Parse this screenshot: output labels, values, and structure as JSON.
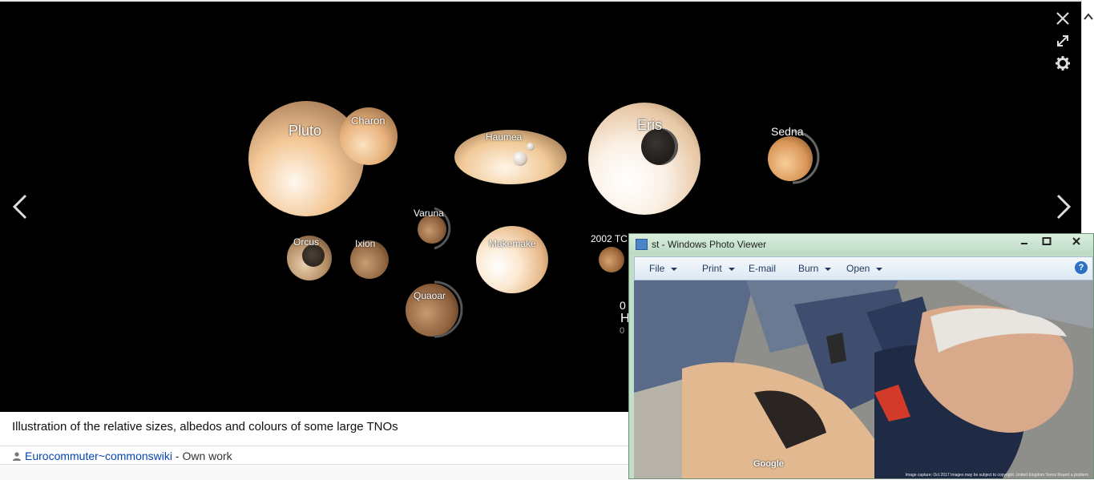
{
  "viewer": {
    "planets": [
      {
        "name": "Pluto"
      },
      {
        "name": "Charon"
      },
      {
        "name": "Haumea"
      },
      {
        "name": "Eris"
      },
      {
        "name": "Sedna"
      },
      {
        "name": "Varuna"
      },
      {
        "name": "Orcus"
      },
      {
        "name": "Ixion"
      },
      {
        "name": "Makemake"
      },
      {
        "name": "Quaoar"
      },
      {
        "name": "2002 TC"
      }
    ],
    "partial_text": [
      "0",
      "H",
      "0"
    ],
    "icons": {
      "close": "close-icon",
      "expand": "expand-icon",
      "settings": "gear-icon",
      "prev": "chevron-left-icon",
      "next": "chevron-right-icon"
    }
  },
  "caption": "Illustration of the relative sizes, albedos and colours of some large TNOs",
  "author": {
    "name": "Eurocommuter~commonswiki",
    "suffix": " - Own work"
  },
  "photo_viewer": {
    "title": "st - Windows Photo Viewer",
    "menu": [
      {
        "label": "File"
      },
      {
        "label": "Print"
      },
      {
        "label": "E-mail"
      },
      {
        "label": "Burn"
      },
      {
        "label": "Open"
      }
    ],
    "help": "?",
    "watermark": "Google",
    "fine_print": "Image capture: Oct 2017   Images may be subject to copyright.   United Kingdom   Terms   Report a problem"
  }
}
